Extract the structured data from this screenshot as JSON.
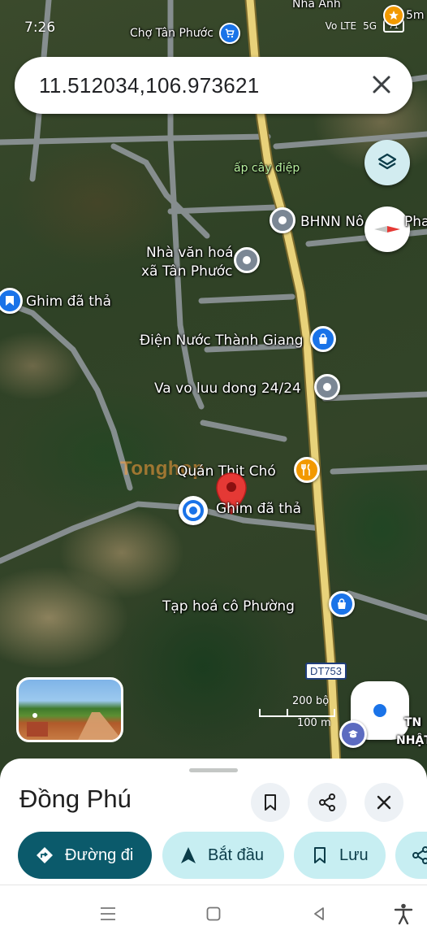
{
  "status_bar": {
    "time": "7:26",
    "network": "Vo LTE",
    "signal": "5G",
    "battery": "71"
  },
  "search": {
    "query": "11.512034,106.973621"
  },
  "map": {
    "labels": {
      "top_nha_anh": "Nha Anh",
      "top_5m": "5m",
      "cho_tan_phuoc": "Chợ Tân Phước",
      "ap_cay_diep": "ấp cây điệp",
      "bhnn": "BHNN Nô",
      "bhnn_suffix": "Pha",
      "nha_van_hoa_1": "Nhà văn hoá",
      "nha_van_hoa_2": "xã Tân Phước",
      "ghim_da_tha_left": "Ghim đã thả",
      "dien_nuoc": "Điện Nước Thành Giang",
      "va_vo": "Va vo luu dong 24/24",
      "quan_thit_cho": "Quán Thịt Chó",
      "ghim_da_tha_center": "Ghim đã thả",
      "tap_hoa": "Tạp hoá cô Phường",
      "road_shield": "DT753",
      "corner_1": "TN",
      "corner_2": "NHẬT"
    },
    "watermark": "Tonghop",
    "scale": {
      "upper": "200 bộ",
      "lower": "100 m"
    },
    "icons": {
      "layers": "layers-icon",
      "compass": "compass-icon",
      "my_location": "my-location-icon"
    }
  },
  "place_sheet": {
    "title": "Đồng Phú",
    "actions": [
      {
        "label": "Đường đi",
        "icon": "directions-icon"
      },
      {
        "label": "Bắt đầu",
        "icon": "navigation-arrow-icon"
      },
      {
        "label": "Lưu",
        "icon": "bookmark-icon"
      },
      {
        "label": "",
        "icon": "share-icon"
      }
    ]
  },
  "colors": {
    "primary_chip": "#0b5a6b",
    "secondary_chip": "#c7eef2",
    "dropped_pin": "#e53935",
    "highway": "#e8d27a"
  }
}
